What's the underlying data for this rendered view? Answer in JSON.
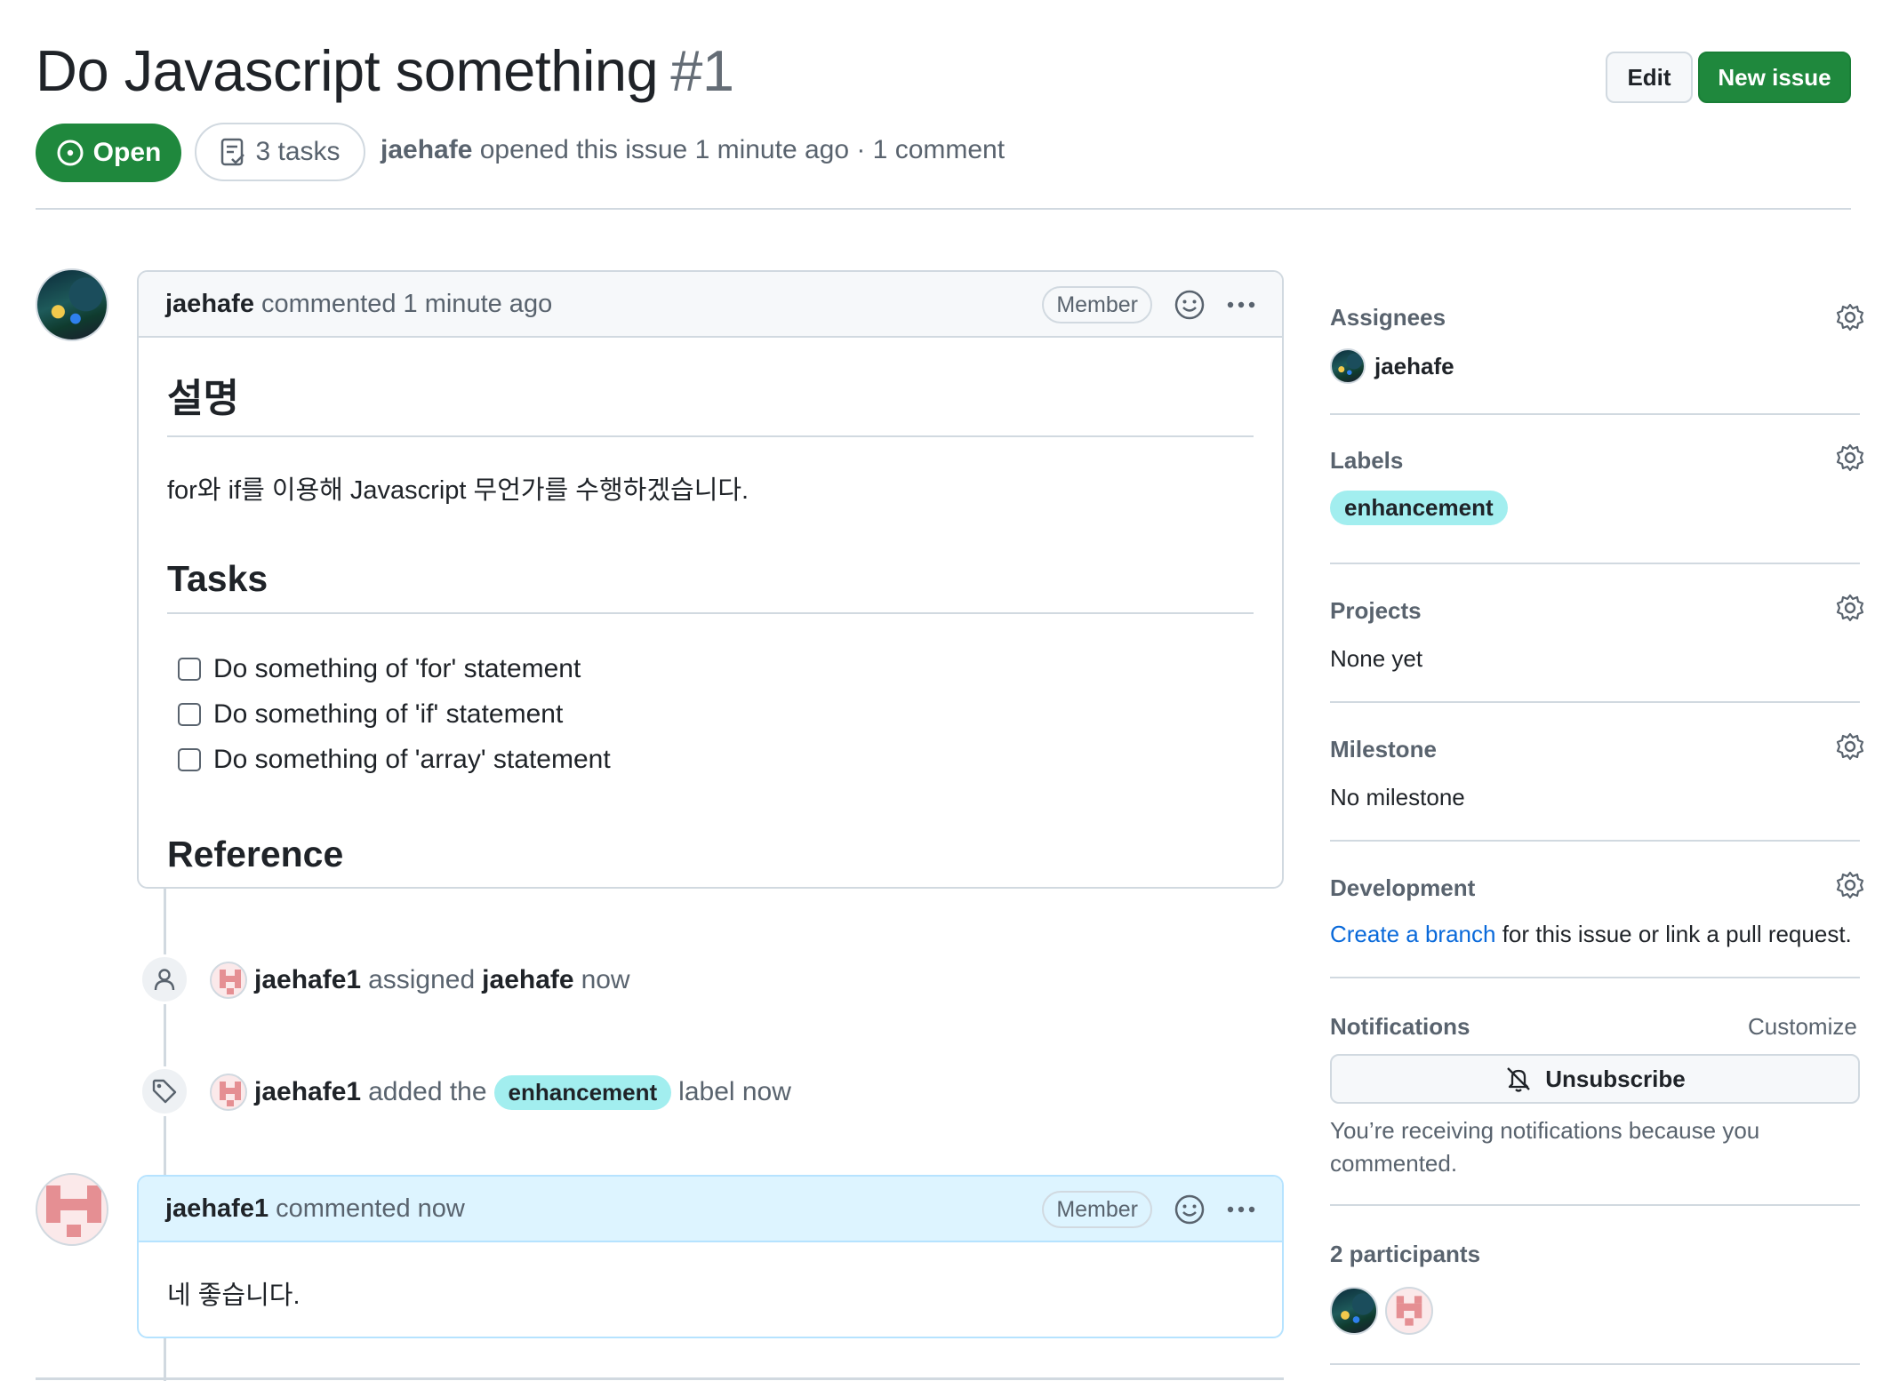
{
  "issue": {
    "title": "Do Javascript something",
    "number": "#1",
    "state": "Open",
    "tasks_pill": "3 tasks",
    "author": "jaehafe",
    "meta_text": "opened this issue 1 minute ago · 1 comment"
  },
  "header_buttons": {
    "edit": "Edit",
    "new_issue": "New issue"
  },
  "first_comment": {
    "author": "jaehafe",
    "time": "commented 1 minute ago",
    "badge": "Member",
    "heading_desc": "설명",
    "description": "for와 if를 이용해 Javascript 무언가를 수행하겠습니다.",
    "heading_tasks": "Tasks",
    "tasks": [
      "Do something of 'for' statement",
      "Do something of 'if' statement",
      "Do something of 'array' statement"
    ],
    "heading_reference": "Reference"
  },
  "events": [
    {
      "icon": "person-icon",
      "actor": "jaehafe1",
      "action": "assigned",
      "target": "jaehafe",
      "time": "now"
    },
    {
      "icon": "tag-icon",
      "actor": "jaehafe1",
      "action": "added the",
      "label": "enhancement",
      "suffix": "label now"
    }
  ],
  "second_comment": {
    "author": "jaehafe1",
    "time": "commented now",
    "badge": "Member",
    "body": "네 좋습니다."
  },
  "sidebar": {
    "assignees": {
      "title": "Assignees",
      "user": "jaehafe"
    },
    "labels": {
      "title": "Labels",
      "label": "enhancement",
      "label_color": "#a2eeef"
    },
    "projects": {
      "title": "Projects",
      "value": "None yet"
    },
    "milestone": {
      "title": "Milestone",
      "value": "No milestone"
    },
    "development": {
      "title": "Development",
      "link_text": "Create a branch",
      "rest_text": "for this issue or link a pull request."
    },
    "notifications": {
      "title": "Notifications",
      "customize": "Customize",
      "button": "Unsubscribe",
      "reason_line1": "You’re receiving notifications because you",
      "reason_line2": "commented."
    },
    "participants": {
      "title": "2 participants"
    }
  },
  "colors": {
    "green": "#1f883d",
    "border": "#d1d9e0",
    "muted": "#59636e",
    "link": "#0969da",
    "blue_header": "#ddf4ff"
  }
}
